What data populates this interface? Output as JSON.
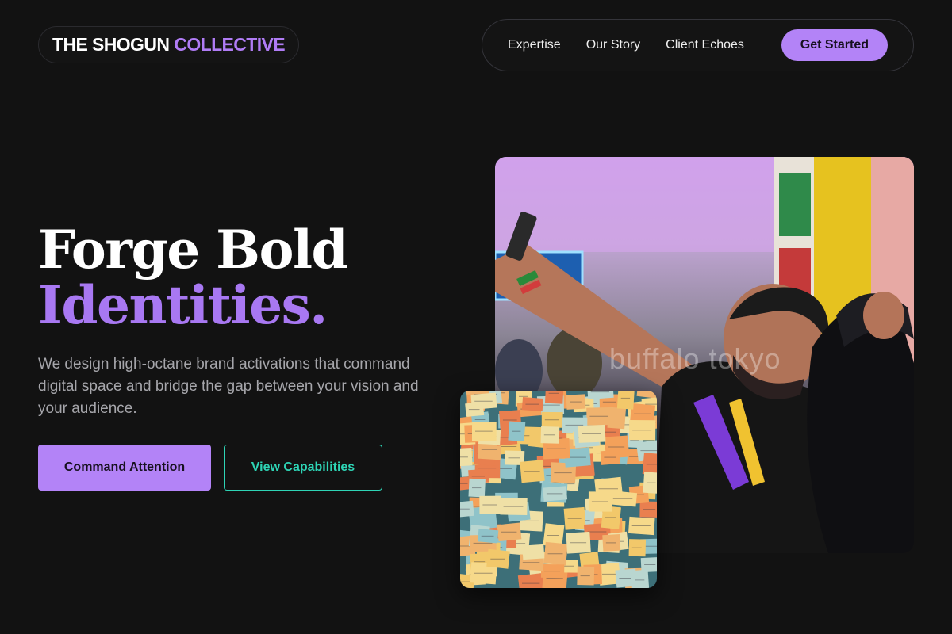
{
  "brand": {
    "name_part1": "THE SHOGUN",
    "name_part2": "COLLECTIVE"
  },
  "nav": {
    "items": [
      {
        "label": "Expertise"
      },
      {
        "label": "Our Story"
      },
      {
        "label": "Client Echoes"
      }
    ],
    "cta_label": "Get Started"
  },
  "hero": {
    "headline_line1": "Forge Bold",
    "headline_line2": "Identities.",
    "description": "We design high-octane brand activations that command digital space and bridge the gap between your vision and your audience.",
    "primary_button": "Command Attention",
    "secondary_button": "View Capabilities"
  },
  "images": {
    "main_photo_watermark": "buffalo tokyo"
  },
  "colors": {
    "background": "#121212",
    "accent_purple": "#b383f7",
    "accent_teal": "#2ed4b5",
    "text_muted": "#a6a6ab"
  }
}
